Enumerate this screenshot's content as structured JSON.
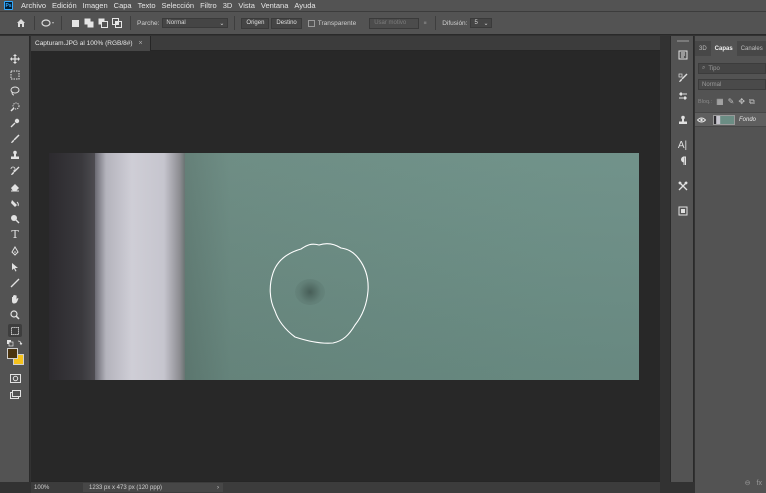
{
  "menu": {
    "items": [
      "Archivo",
      "Edición",
      "Imagen",
      "Capa",
      "Texto",
      "Selección",
      "Filtro",
      "3D",
      "Vista",
      "Ventana",
      "Ayuda"
    ]
  },
  "options": {
    "parche_label": "Parche:",
    "parche_value": "Normal",
    "origen": "Origen",
    "destino": "Destino",
    "transparente": "Transparente",
    "usar_motivo": "Usar motivo",
    "difusion_label": "Difusión:",
    "difusion_value": "5"
  },
  "document": {
    "tab_title": "Capturam.JPG al 100% (RGB/8#)",
    "close": "×"
  },
  "status": {
    "zoom": "100%",
    "info": "1233 px x 473 px (120 ppp)",
    "arrow": "›"
  },
  "layers": {
    "tabs": [
      "3D",
      "Capas",
      "Canales"
    ],
    "search_placeholder": "Tipo",
    "blend_mode": "Normal",
    "lock_label": "Bloq.:",
    "layer_name": "Fondo",
    "footer_fx": "fx"
  },
  "colors": {
    "foreground": "#4a3410",
    "background": "#f5c21c",
    "lasso": "#ffffff"
  }
}
